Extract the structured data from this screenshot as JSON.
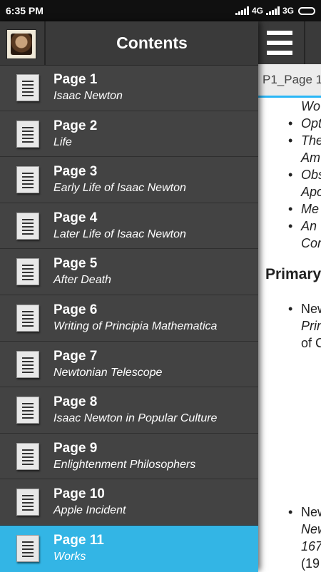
{
  "status": {
    "time": "6:35 PM",
    "net1": "4G",
    "net2": "3G"
  },
  "drawer": {
    "title": "Contents",
    "items": [
      {
        "title": "Page 1",
        "subtitle": "Isaac Newton"
      },
      {
        "title": "Page 2",
        "subtitle": "Life"
      },
      {
        "title": "Page 3",
        "subtitle": "Early Life of Isaac Newton"
      },
      {
        "title": "Page 4",
        "subtitle": "Later Life of Isaac Newton"
      },
      {
        "title": "Page 5",
        "subtitle": "After Death"
      },
      {
        "title": "Page 6",
        "subtitle": "Writing of Principia Mathematica"
      },
      {
        "title": "Page 7",
        "subtitle": "Newtonian Telescope"
      },
      {
        "title": "Page 8",
        "subtitle": "Isaac Newton in Popular Culture"
      },
      {
        "title": "Page 9",
        "subtitle": "Enlightenment Philosophers"
      },
      {
        "title": "Page 10",
        "subtitle": "Apple Incident"
      },
      {
        "title": "Page 11",
        "subtitle": "Works"
      }
    ],
    "active_index": 10
  },
  "content": {
    "tab_label": "P1_Page 1",
    "lines": [
      "Wo",
      "Opt",
      "The",
      "Am",
      "Obs",
      "Apo",
      "Me",
      "An",
      "Cor"
    ],
    "heading": "Primary",
    "lines2": [
      "New",
      "Prin",
      "of C"
    ],
    "lines3": [
      "New",
      "New",
      "167",
      "(19"
    ]
  },
  "colors": {
    "accent": "#33b5e5",
    "drawer_bg": "#434343",
    "header_bg": "#3a3a3a"
  }
}
